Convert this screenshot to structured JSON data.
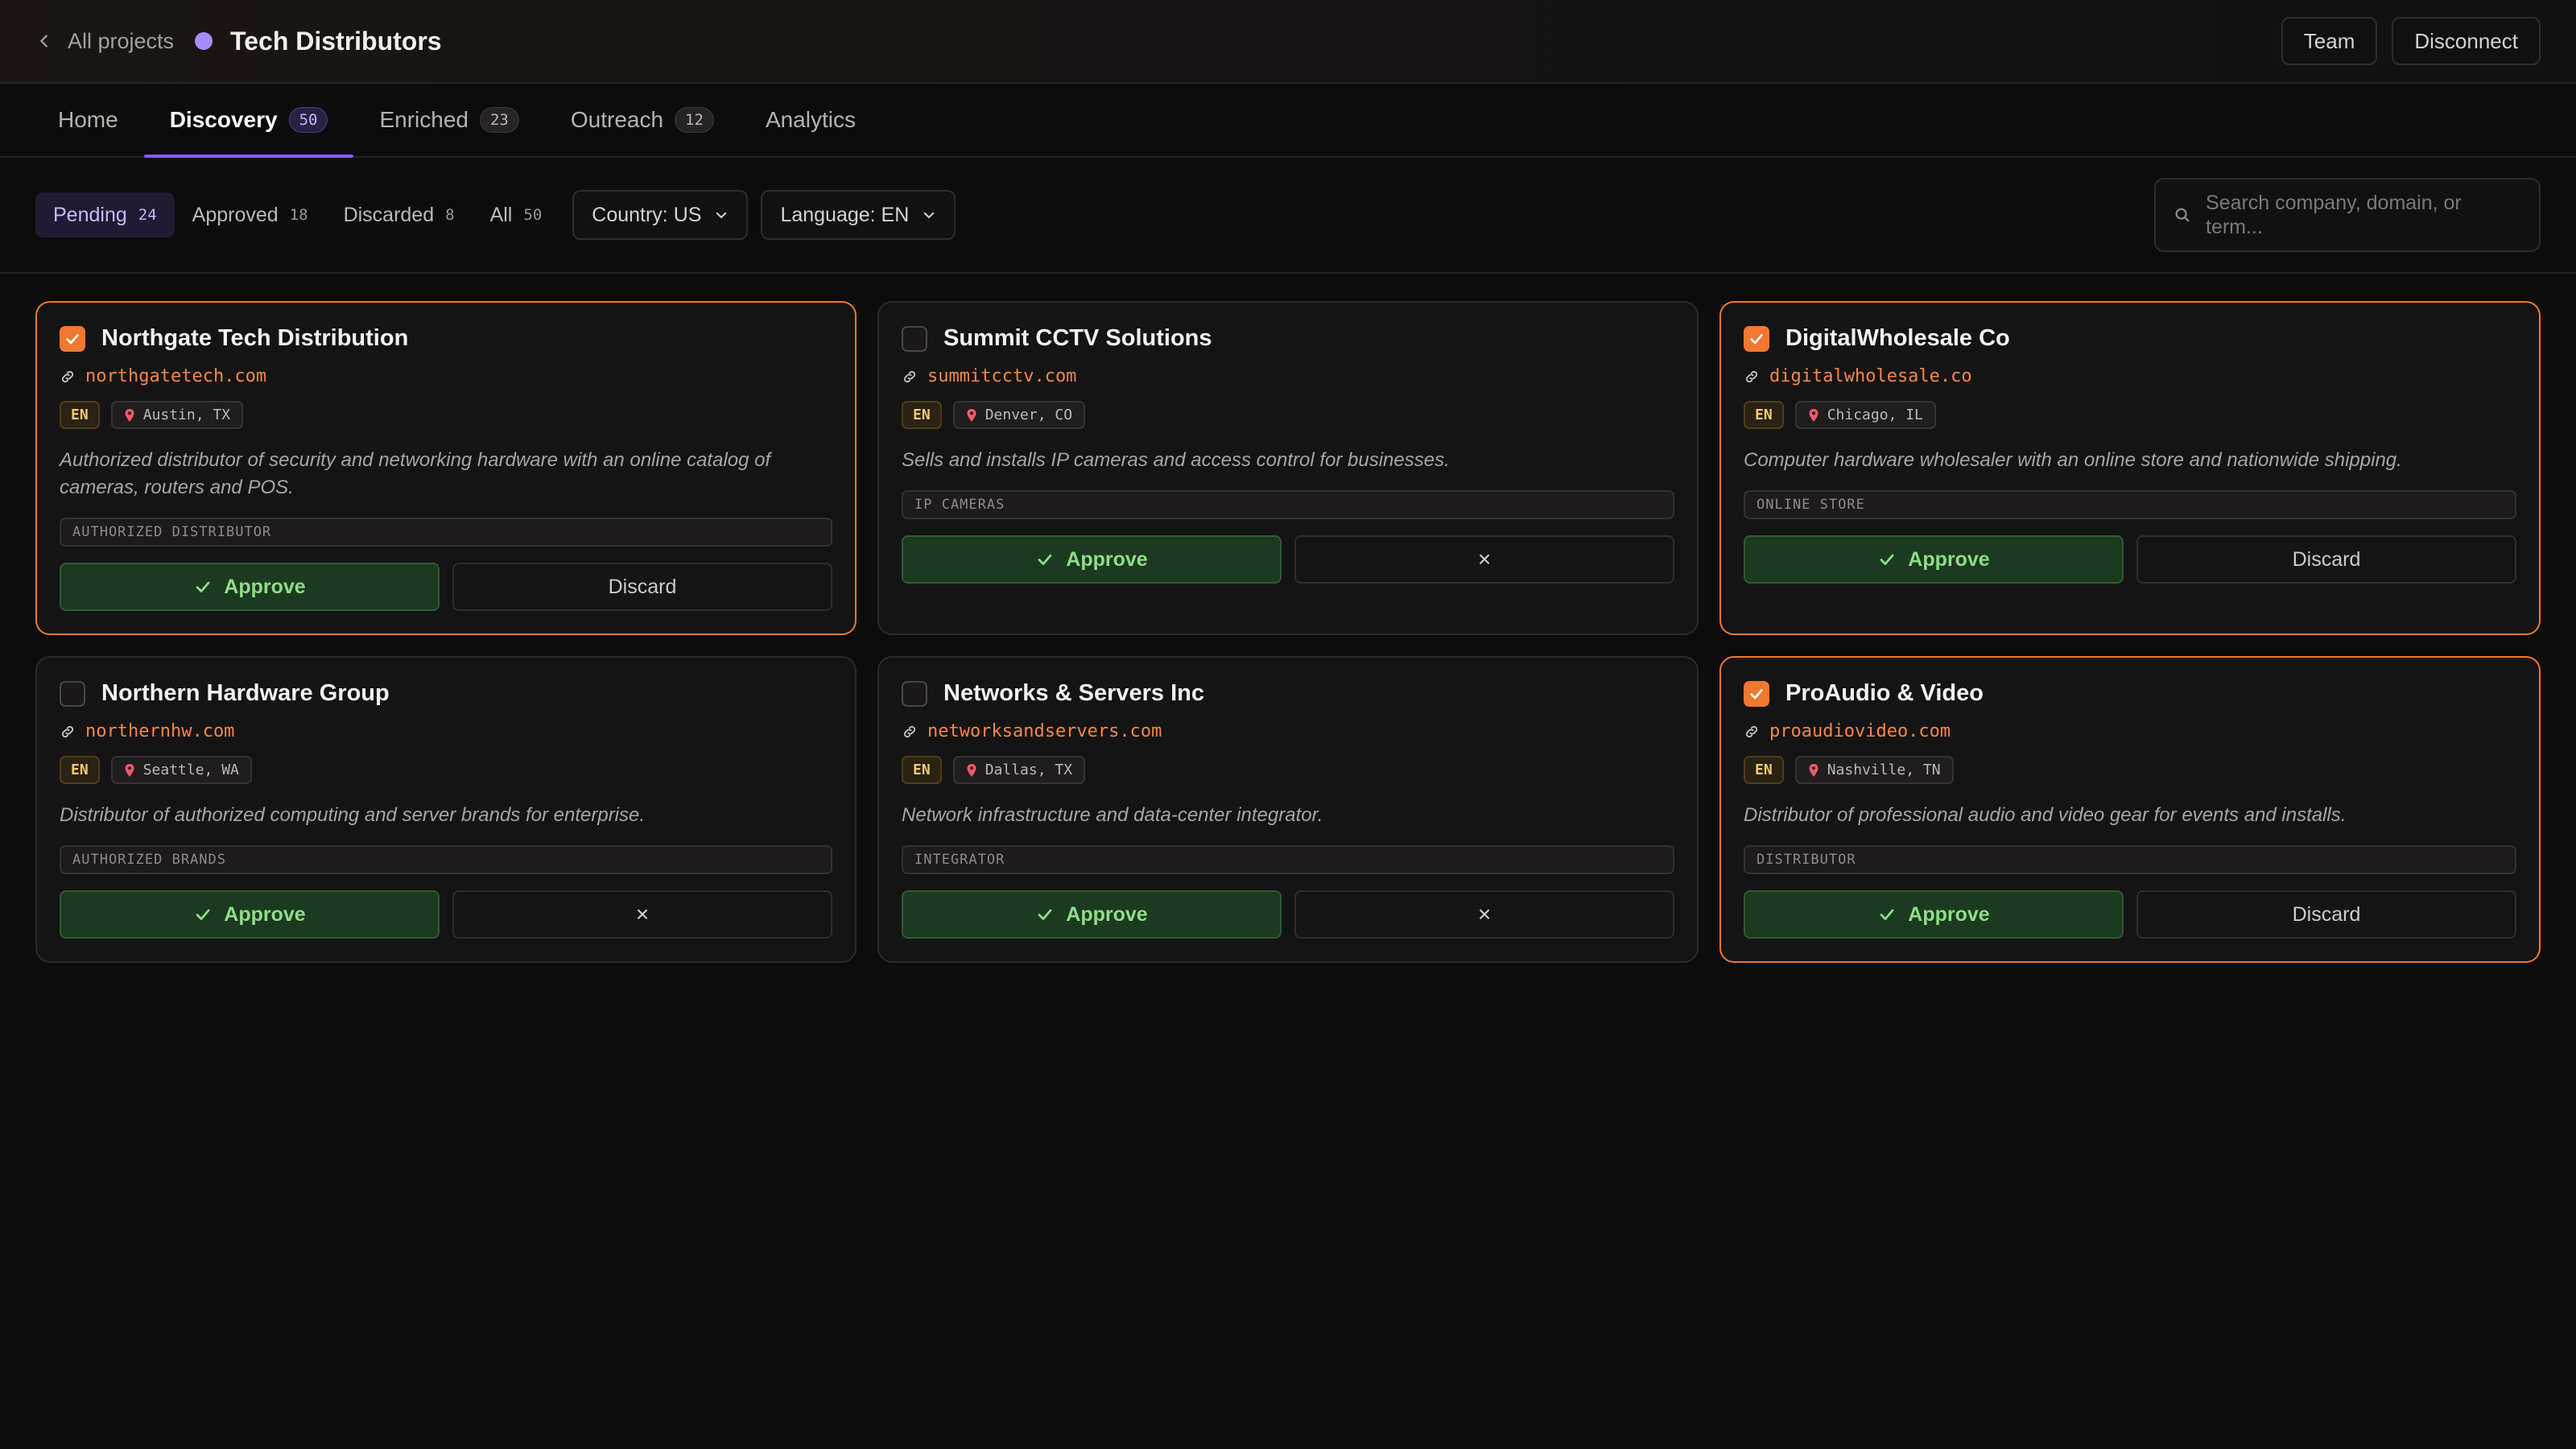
{
  "header": {
    "back_label": "All projects",
    "project_title": "Tech Distributors",
    "project_color": "#a78bfa",
    "team_label": "Team",
    "disconnect_label": "Disconnect"
  },
  "tabs": [
    {
      "label": "Home",
      "count": null,
      "active": false
    },
    {
      "label": "Discovery",
      "count": "50",
      "active": true
    },
    {
      "label": "Enriched",
      "count": "23",
      "active": false
    },
    {
      "label": "Outreach",
      "count": "12",
      "active": false
    },
    {
      "label": "Analytics",
      "count": null,
      "active": false
    }
  ],
  "filters": {
    "status": [
      {
        "label": "Pending",
        "count": "24",
        "active": true
      },
      {
        "label": "Approved",
        "count": "18",
        "active": false
      },
      {
        "label": "Discarded",
        "count": "8",
        "active": false
      },
      {
        "label": "All",
        "count": "50",
        "active": false
      }
    ],
    "country_select": "Country: US",
    "language_select": "Language: EN",
    "search_placeholder": "Search company, domain, or term..."
  },
  "colors": {
    "accent_purple": "#8b5cf6",
    "selected_border": "#f0782f",
    "domain_orange": "#f4874a",
    "approve_green": "#8fdc8a"
  },
  "cards": [
    {
      "name": "Northgate Tech Distribution",
      "domain": "northgatetech.com",
      "lang": "EN",
      "location": "Austin, TX",
      "description": "Authorized distributor of security and networking hardware with an online catalog of cameras, routers and POS.",
      "tag": "AUTHORIZED DISTRIBUTOR",
      "selected": true,
      "approve_label": "Approve",
      "discard_label": "Discard"
    },
    {
      "name": "Summit CCTV Solutions",
      "domain": "summitcctv.com",
      "lang": "EN",
      "location": "Denver, CO",
      "description": "Sells and installs IP cameras and access control for businesses.",
      "tag": "IP CAMERAS",
      "selected": false,
      "approve_label": "Approve",
      "discard_label": "×"
    },
    {
      "name": "DigitalWholesale Co",
      "domain": "digitalwholesale.co",
      "lang": "EN",
      "location": "Chicago, IL",
      "description": "Computer hardware wholesaler with an online store and nationwide shipping.",
      "tag": "ONLINE STORE",
      "selected": true,
      "approve_label": "Approve",
      "discard_label": "Discard"
    },
    {
      "name": "Northern Hardware Group",
      "domain": "northernhw.com",
      "lang": "EN",
      "location": "Seattle, WA",
      "description": "Distributor of authorized computing and server brands for enterprise.",
      "tag": "AUTHORIZED BRANDS",
      "selected": false,
      "approve_label": "Approve",
      "discard_label": "×"
    },
    {
      "name": "Networks & Servers Inc",
      "domain": "networksandservers.com",
      "lang": "EN",
      "location": "Dallas, TX",
      "description": "Network infrastructure and data-center integrator.",
      "tag": "INTEGRATOR",
      "selected": false,
      "approve_label": "Approve",
      "discard_label": "×"
    },
    {
      "name": "ProAudio & Video",
      "domain": "proaudiovideo.com",
      "lang": "EN",
      "location": "Nashville, TN",
      "description": "Distributor of professional audio and video gear for events and installs.",
      "tag": "DISTRIBUTOR",
      "selected": true,
      "approve_label": "Approve",
      "discard_label": "Discard"
    }
  ]
}
